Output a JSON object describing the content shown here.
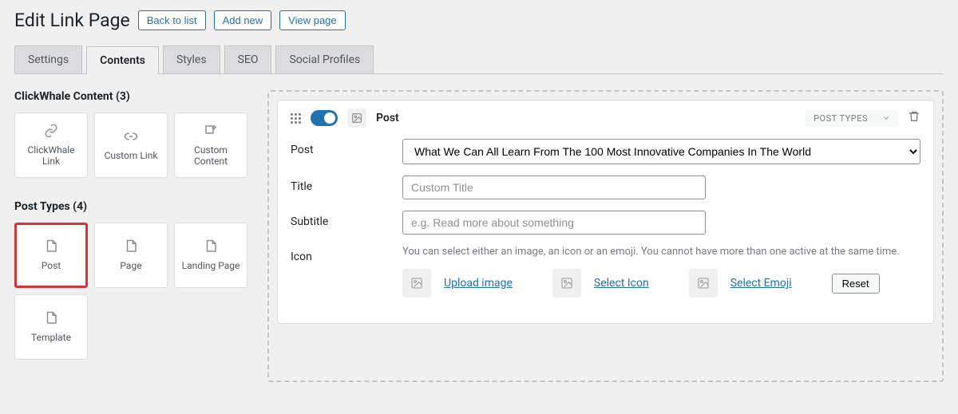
{
  "header": {
    "title": "Edit Link Page",
    "buttons": {
      "back": "Back to list",
      "addNew": "Add new",
      "view": "View page"
    }
  },
  "tabs": {
    "settings": "Settings",
    "contents": "Contents",
    "styles": "Styles",
    "seo": "SEO",
    "social": "Social Profiles"
  },
  "sidebar": {
    "cwContent": {
      "title": "ClickWhale Content (3)",
      "items": {
        "link": "ClickWhale Link",
        "customLink": "Custom Link",
        "customContent": "Custom Content"
      }
    },
    "postTypes": {
      "title": "Post Types (4)",
      "items": {
        "post": "Post",
        "page": "Page",
        "landing": "Landing Page",
        "template": "Template"
      }
    }
  },
  "card": {
    "typeLabel": "Post",
    "ptSelector": "POST TYPES",
    "form": {
      "postLabel": "Post",
      "postValue": "What We Can All Learn From The 100 Most Innovative Companies In The World",
      "titleLabel": "Title",
      "titlePlaceholder": "Custom Title",
      "subtitleLabel": "Subtitle",
      "subtitlePlaceholder": "e.g. Read more about something",
      "iconLabel": "Icon",
      "iconHelp": "You can select either an image, an icon or an emoji. You cannot have more than one active at the same time.",
      "uploadImage": "Upload image",
      "selectIcon": "Select Icon",
      "selectEmoji": "Select Emoji",
      "reset": "Reset"
    }
  }
}
